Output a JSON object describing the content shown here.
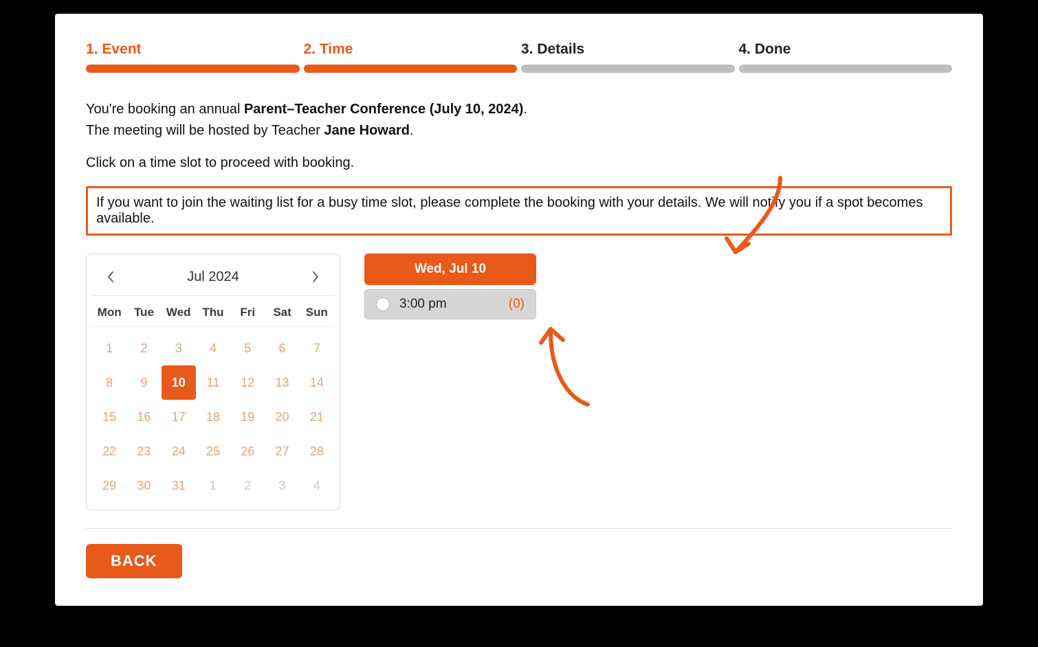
{
  "steps": [
    {
      "label": "1. Event",
      "active": true
    },
    {
      "label": "2. Time",
      "active": true
    },
    {
      "label": "3. Details",
      "active": false
    },
    {
      "label": "4. Done",
      "active": false
    }
  ],
  "intro": {
    "prefix": "You're booking an annual ",
    "event_bold": "Parent–Teacher Conference (July 10, 2024)",
    "event_suffix": ".",
    "host_prefix": "The meeting will be hosted by Teacher ",
    "host_bold": "Jane Howard",
    "host_suffix": "."
  },
  "instruction": "Click on a time slot to proceed with booking.",
  "notice": "If you want to join the waiting list for a busy time slot, please complete the booking with your details. We will notify you if a spot becomes available.",
  "calendar": {
    "title": "Jul 2024",
    "dow": [
      "Mon",
      "Tue",
      "Wed",
      "Thu",
      "Fri",
      "Sat",
      "Sun"
    ],
    "weeks": [
      [
        {
          "n": "1"
        },
        {
          "n": "2"
        },
        {
          "n": "3"
        },
        {
          "n": "4"
        },
        {
          "n": "5"
        },
        {
          "n": "6"
        },
        {
          "n": "7"
        }
      ],
      [
        {
          "n": "8"
        },
        {
          "n": "9"
        },
        {
          "n": "10",
          "selected": true
        },
        {
          "n": "11"
        },
        {
          "n": "12"
        },
        {
          "n": "13"
        },
        {
          "n": "14"
        }
      ],
      [
        {
          "n": "15"
        },
        {
          "n": "16"
        },
        {
          "n": "17"
        },
        {
          "n": "18"
        },
        {
          "n": "19"
        },
        {
          "n": "20"
        },
        {
          "n": "21"
        }
      ],
      [
        {
          "n": "22"
        },
        {
          "n": "23"
        },
        {
          "n": "24"
        },
        {
          "n": "25"
        },
        {
          "n": "26"
        },
        {
          "n": "27"
        },
        {
          "n": "28"
        }
      ],
      [
        {
          "n": "29"
        },
        {
          "n": "30"
        },
        {
          "n": "31"
        },
        {
          "n": "1",
          "other": true
        },
        {
          "n": "2",
          "other": true
        },
        {
          "n": "3",
          "other": true
        },
        {
          "n": "4",
          "other": true
        }
      ]
    ]
  },
  "slots": {
    "day_label": "Wed, Jul 10",
    "items": [
      {
        "time": "3:00 pm",
        "count": "(0)"
      }
    ]
  },
  "back_label": "BACK",
  "colors": {
    "accent": "#e85a1a"
  }
}
